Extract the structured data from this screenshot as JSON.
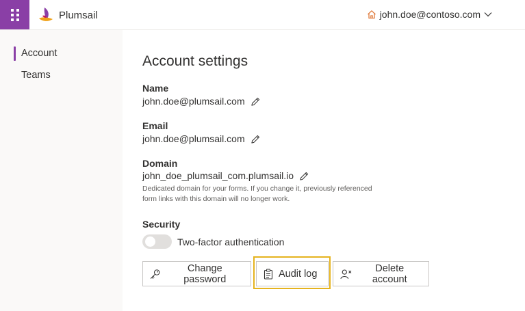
{
  "header": {
    "app_launcher_icon": "grid-dots-icon",
    "brand_name": "Plumsail",
    "user_email": "john.doe@contoso.com",
    "home_icon": "home-icon",
    "dropdown_icon": "chevron-down-icon"
  },
  "sidebar": {
    "items": [
      {
        "label": "Account",
        "active": true
      },
      {
        "label": "Teams",
        "active": false
      }
    ]
  },
  "main": {
    "title": "Account settings",
    "name": {
      "label": "Name",
      "value": "john.doe@plumsail.com"
    },
    "email": {
      "label": "Email",
      "value": "john.doe@plumsail.com"
    },
    "domain": {
      "label": "Domain",
      "value": "john_doe_plumsail_com.plumsail.io",
      "hint_line1": "Dedicated domain for your forms. If you change it, previously referenced",
      "hint_line2": "form links with this domain will no longer work."
    },
    "security": {
      "label": "Security",
      "two_factor_label": "Two-factor authentication",
      "two_factor_enabled": false
    },
    "buttons": {
      "change_password": "Change password",
      "audit_log": "Audit log",
      "delete_account": "Delete account"
    }
  },
  "colors": {
    "accent": "#8a3fa6",
    "highlight": "#e5b31e",
    "home_icon": "#e07b3c"
  }
}
